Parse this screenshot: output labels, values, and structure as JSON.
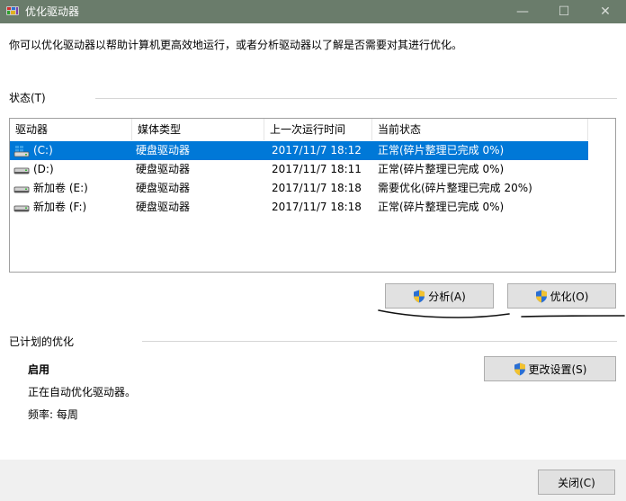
{
  "window": {
    "title": "优化驱动器",
    "min_glyph": "—",
    "max_glyph": "☐",
    "close_glyph": "✕"
  },
  "description": "你可以优化驱动器以帮助计算机更高效地运行，或者分析驱动器以了解是否需要对其进行优化。",
  "status": {
    "label": "状态(T)",
    "columns": [
      "驱动器",
      "媒体类型",
      "上一次运行时间",
      "当前状态"
    ],
    "rows": [
      {
        "drive": "(C:)",
        "media": "硬盘驱动器",
        "last_run": "2017/11/7 18:12",
        "status": "正常(碎片整理已完成 0%)",
        "icon": "windows-drive-icon",
        "selected": true
      },
      {
        "drive": "(D:)",
        "media": "硬盘驱动器",
        "last_run": "2017/11/7 18:11",
        "status": "正常(碎片整理已完成 0%)",
        "icon": "hard-drive-icon",
        "selected": false
      },
      {
        "drive": "新加卷 (E:)",
        "media": "硬盘驱动器",
        "last_run": "2017/11/7 18:18",
        "status": "需要优化(碎片整理已完成 20%)",
        "icon": "hard-drive-icon",
        "selected": false
      },
      {
        "drive": "新加卷 (F:)",
        "media": "硬盘驱动器",
        "last_run": "2017/11/7 18:18",
        "status": "正常(碎片整理已完成 0%)",
        "icon": "hard-drive-icon",
        "selected": false
      }
    ]
  },
  "actions": {
    "analyze_label": "分析(A)",
    "optimize_label": "优化(O)"
  },
  "scheduled": {
    "label": "已计划的优化",
    "state": "启用",
    "description": "正在自动优化驱动器。",
    "frequency": "频率: 每周",
    "change_settings_label": "更改设置(S)"
  },
  "footer": {
    "close_label": "关闭(C)"
  },
  "colors": {
    "titlebar": "#6a7c6b",
    "selection": "#0078d7",
    "button_face": "#e1e1e1",
    "footer": "#f0f0f0"
  }
}
